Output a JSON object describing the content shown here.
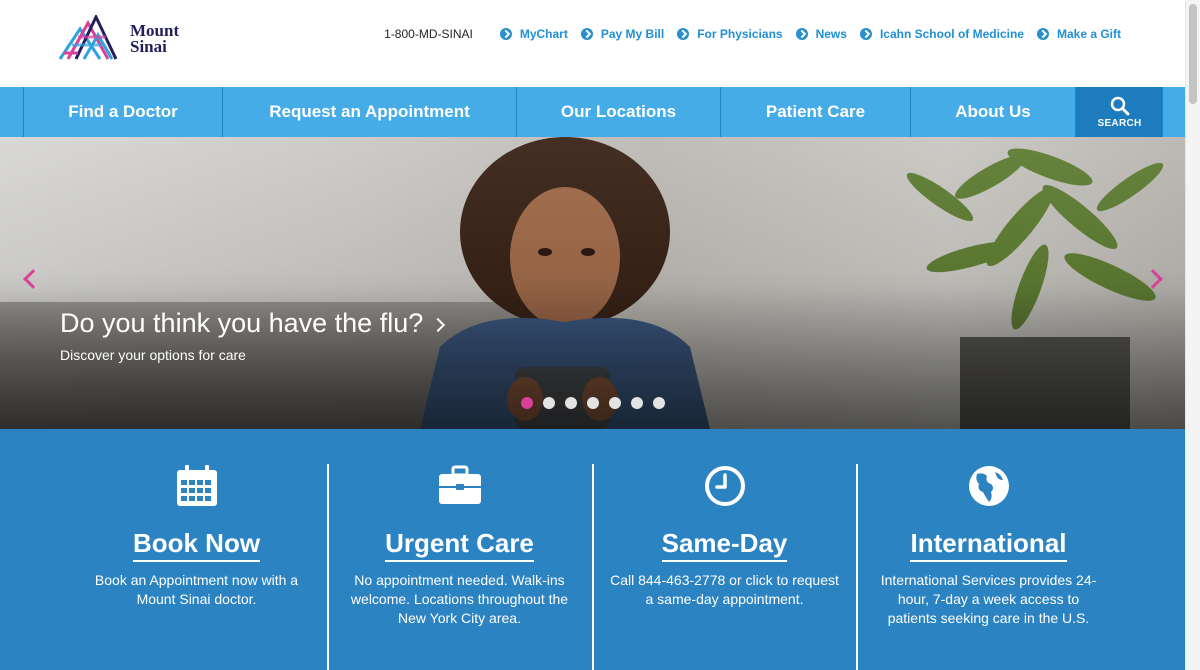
{
  "header": {
    "logo_text_line1": "Mount",
    "logo_text_line2": "Sinai",
    "phone": "1-800-MD-SINAI",
    "links": [
      "MyChart",
      "Pay My Bill",
      "For Physicians",
      "News",
      "Icahn School of Medicine",
      "Make a Gift"
    ]
  },
  "nav": {
    "items": [
      "Find a Doctor",
      "Request an Appointment",
      "Our Locations",
      "Patient Care",
      "About Us"
    ],
    "search_label": "SEARCH"
  },
  "hero": {
    "title": "Do you think you have the flu?",
    "subtitle": "Discover your options for care",
    "slide_count": 7,
    "active_slide": 1
  },
  "tiles": [
    {
      "icon": "calendar-icon",
      "title": "Book Now",
      "description": "Book an Appointment now with a Mount Sinai doctor."
    },
    {
      "icon": "briefcase-icon",
      "title": "Urgent Care",
      "description": "No appointment needed. Walk-ins welcome. Locations throughout the New York City area."
    },
    {
      "icon": "clock-icon",
      "title": "Same-Day",
      "description": "Call 844-463-2778 or click to request a same-day appointment."
    },
    {
      "icon": "globe-icon",
      "title": "International",
      "description": "International Services provides 24-hour, 7-day a week access to patients seeking care in the U.S."
    }
  ],
  "colors": {
    "nav_blue": "#45ace8",
    "search_blue": "#1c7cbd",
    "tiles_blue": "#2b83c2",
    "link_blue": "#1f8fd6",
    "accent_pink": "#d9409a",
    "logo_navy": "#221f5b"
  }
}
